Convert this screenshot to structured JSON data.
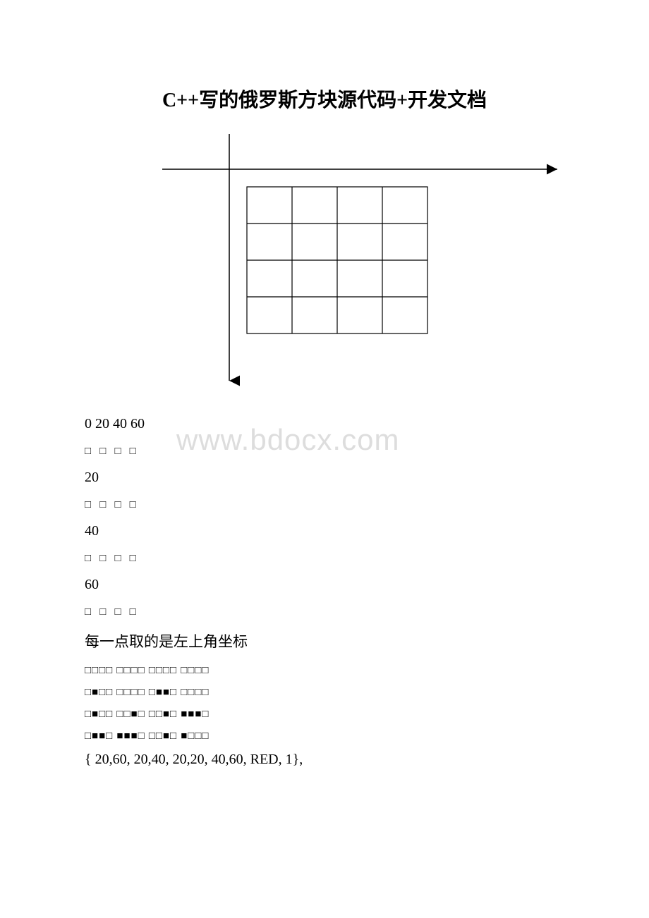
{
  "title": "C++写的俄罗斯方块源代码+开发文档",
  "watermark": "www.bdocx.com",
  "coord_header": "0 20 40 60",
  "rows": [
    {
      "boxes": "□ □ □ □",
      "label": "20"
    },
    {
      "boxes": "□ □ □ □",
      "label": "40"
    },
    {
      "boxes": "□ □ □ □",
      "label": "60"
    },
    {
      "boxes": "□ □ □ □",
      "label": ""
    }
  ],
  "note": "每一点取的是左上角坐标",
  "shapes": [
    "□□□□ □□□□ □□□□ □□□□",
    "□■□□ □□□□ □■■□ □□□□",
    "□■□□ □□■□ □□■□ ■■■□",
    "□■■□ ■■■□ □□■□ ■□□□"
  ],
  "code_line": "{ 20,60, 20,40, 20,20, 40,60, RED, 1},"
}
